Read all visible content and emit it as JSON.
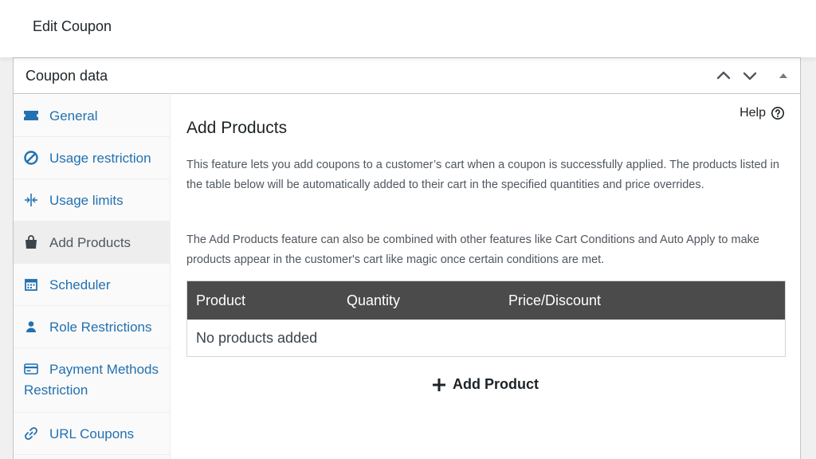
{
  "header": {
    "title": "Edit Coupon"
  },
  "panel": {
    "title": "Coupon data",
    "controls": {
      "up": "chevron-up-icon",
      "down": "chevron-down-icon",
      "toggle": "triangle-up-icon"
    }
  },
  "sidebar": {
    "items": [
      {
        "label": "General",
        "icon": "ticket-icon"
      },
      {
        "label": "Usage restriction",
        "icon": "block-icon"
      },
      {
        "label": "Usage limits",
        "icon": "limits-icon"
      },
      {
        "label": "Add Products",
        "icon": "bag-icon",
        "active": true
      },
      {
        "label": "Scheduler",
        "icon": "calendar-icon"
      },
      {
        "label": "Role Restrictions",
        "icon": "user-icon"
      },
      {
        "label_line1": "Payment Methods",
        "label_line2": "Restriction",
        "icon": "card-icon"
      },
      {
        "label": "URL Coupons",
        "icon": "link-icon"
      }
    ]
  },
  "main": {
    "help_label": "Help",
    "title": "Add Products",
    "desc1": "This feature lets you add coupons to a customer’s cart when a coupon is successfully applied. The products listed in the table below will be automatically added to their cart in the specified quantities and price overrides.",
    "desc2": "The Add Products feature can also be combined with other features like Cart Conditions and Auto Apply to make products appear in the customer's cart like magic once certain conditions are met.",
    "table": {
      "columns": [
        "Product",
        "Quantity",
        "Price/Discount"
      ],
      "empty_text": "No products added"
    },
    "add_product_label": "Add Product"
  },
  "colors": {
    "link": "#2271b1",
    "table_header": "#4b4b4b",
    "active_tab_bg": "#eeeeee"
  }
}
